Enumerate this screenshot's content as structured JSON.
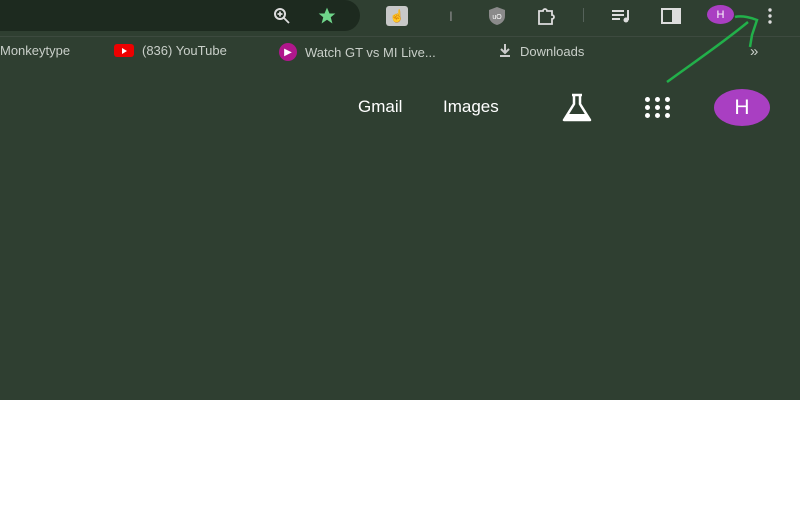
{
  "toolbar": {
    "icons": [
      "zoom-icon",
      "bookmark-star-icon",
      "extension-touch-icon",
      "extension-text-cursor-icon",
      "ublock-icon",
      "extensions-puzzle-icon",
      "media-playlist-icon",
      "side-panel-icon",
      "profile-avatar",
      "menu-kebab-icon"
    ],
    "profile_initial": "H",
    "star_color": "#6fd58a"
  },
  "bookmarks": {
    "items": [
      {
        "label": "Monkeytype"
      },
      {
        "label": "(836) YouTube",
        "icon": "youtube-icon"
      },
      {
        "label": "Watch GT vs MI Live...",
        "icon": "hotstar-icon"
      },
      {
        "label": "Downloads",
        "icon": "download-icon"
      }
    ],
    "more": "»"
  },
  "google_header": {
    "gmail": "Gmail",
    "images": "Images",
    "labs_icon": "flask-icon",
    "apps_icon": "apps-grid-icon",
    "avatar_initial": "H",
    "avatar_color": "#a93fc2"
  },
  "annotation": {
    "color": "#22b04a",
    "points_to": "menu-kebab-icon"
  },
  "colors": {
    "background": "#2f3f31",
    "omnibox": "#1d2a1f"
  }
}
